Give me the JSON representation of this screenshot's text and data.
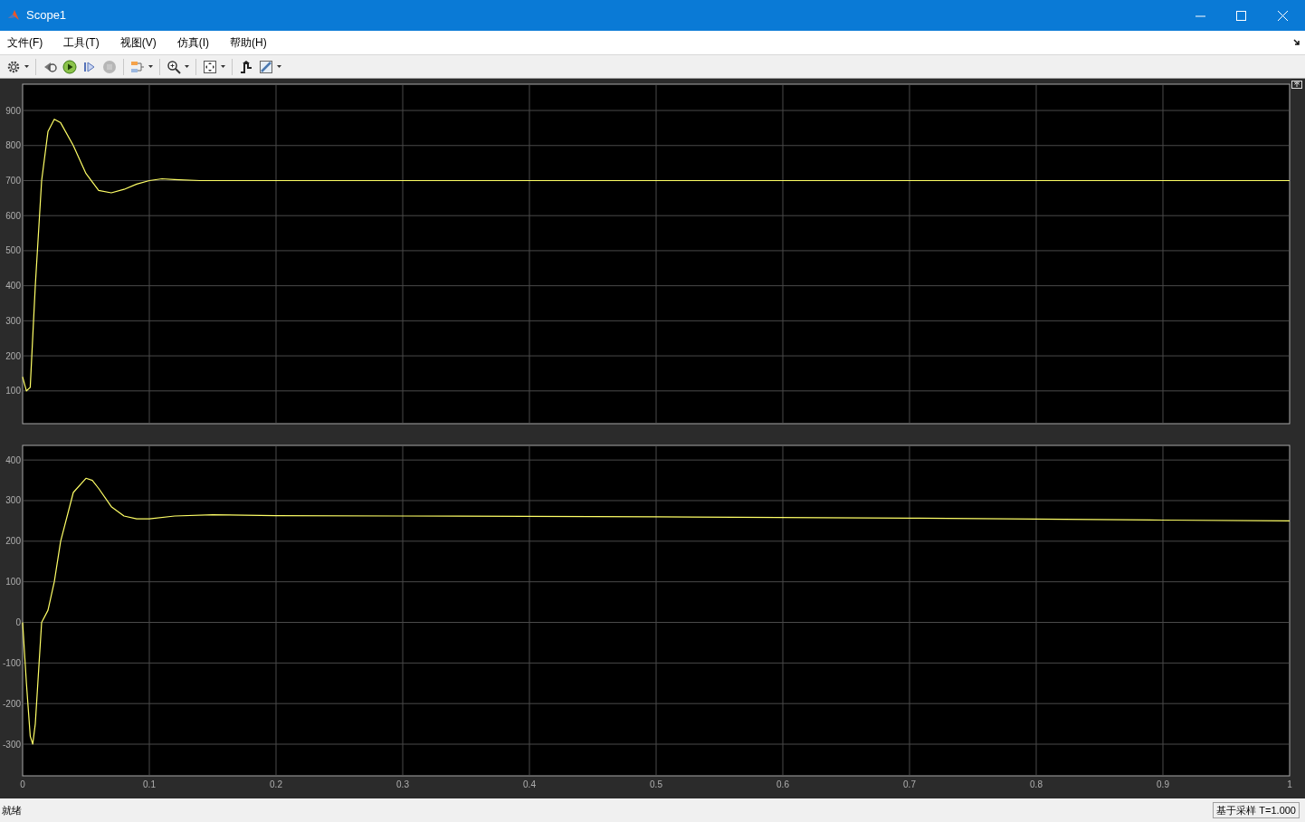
{
  "window": {
    "title": "Scope1"
  },
  "menu": [
    "文件(F)",
    "工具(T)",
    "视图(V)",
    "仿真(I)",
    "帮助(H)"
  ],
  "toolbar": [
    {
      "kind": "settings",
      "dropdown": true,
      "disabled": false
    },
    {
      "kind": "rewind",
      "dropdown": false,
      "disabled": false
    },
    {
      "kind": "run",
      "dropdown": false,
      "disabled": false
    },
    {
      "kind": "step",
      "dropdown": false,
      "disabled": false
    },
    {
      "kind": "stop",
      "dropdown": false,
      "disabled": true
    },
    {
      "kind": "signals",
      "dropdown": true,
      "disabled": false
    },
    {
      "kind": "zoom",
      "dropdown": true,
      "disabled": false
    },
    {
      "kind": "fit",
      "dropdown": true,
      "disabled": false
    },
    {
      "kind": "trigger",
      "dropdown": false,
      "disabled": false
    },
    {
      "kind": "measure",
      "dropdown": true,
      "disabled": false
    }
  ],
  "plots": [
    {
      "chart_data": {
        "type": "line",
        "grid": true,
        "xlim": [
          0,
          1
        ],
        "ylim": [
          6.5,
          975
        ],
        "yticks": [
          100,
          200,
          300,
          400,
          500,
          600,
          700,
          800,
          900
        ],
        "x": [
          0,
          0.003,
          0.006,
          0.01,
          0.015,
          0.02,
          0.025,
          0.03,
          0.04,
          0.05,
          0.06,
          0.07,
          0.08,
          0.09,
          0.1,
          0.11,
          0.12,
          0.14,
          0.2,
          1.0
        ],
        "series": [
          {
            "color": "#ffff66",
            "values": [
              140,
              100,
              110,
              400,
              700,
              840,
              875,
              865,
              800,
              720,
              672,
              665,
              675,
              690,
              700,
              705,
              703,
              700,
              700,
              700
            ]
          }
        ]
      }
    },
    {
      "chart_data": {
        "type": "line",
        "grid": true,
        "xlim": [
          0,
          1
        ],
        "ylim": [
          -378,
          436
        ],
        "xticks": [
          0,
          0.1,
          0.2,
          0.3,
          0.4,
          0.5,
          0.6,
          0.7,
          0.8,
          0.9,
          1
        ],
        "yticks": [
          -300,
          -200,
          -100,
          0,
          100,
          200,
          300,
          400
        ],
        "x": [
          0,
          0.003,
          0.006,
          0.008,
          0.01,
          0.013,
          0.015,
          0.02,
          0.025,
          0.03,
          0.04,
          0.05,
          0.055,
          0.06,
          0.07,
          0.08,
          0.09,
          0.1,
          0.12,
          0.15,
          0.2,
          0.3,
          0.5,
          0.7,
          0.9,
          1.0
        ],
        "series": [
          {
            "color": "#ffff66",
            "values": [
              0,
              -150,
              -280,
              -300,
              -250,
              -100,
              0,
              30,
              100,
              200,
              320,
              355,
              350,
              330,
              285,
              262,
              255,
              255,
              262,
              265,
              263,
              262,
              260,
              257,
              252,
              250
            ]
          }
        ]
      }
    }
  ],
  "status_bar": {
    "left": "就绪",
    "right": "基于采样 T=1.000"
  }
}
